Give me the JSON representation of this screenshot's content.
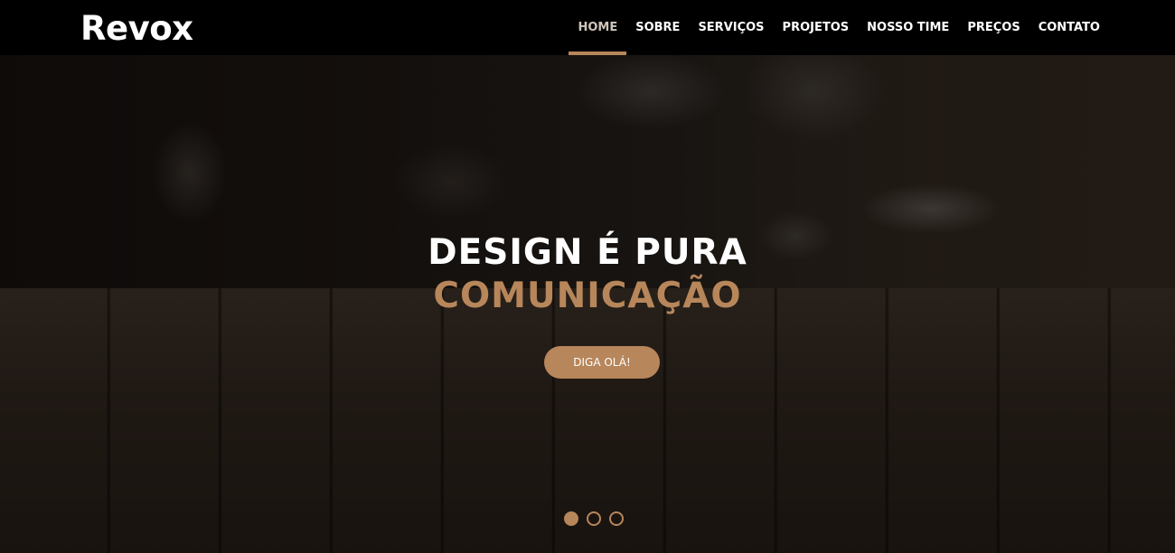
{
  "brand": {
    "name": "Revox"
  },
  "nav": {
    "items": [
      {
        "label": "HOME",
        "active": true
      },
      {
        "label": "SOBRE"
      },
      {
        "label": "SERVIÇOS"
      },
      {
        "label": "PROJETOS"
      },
      {
        "label": "NOSSO TIME"
      },
      {
        "label": "PREÇOS"
      },
      {
        "label": "CONTATO"
      }
    ]
  },
  "hero": {
    "title_line_1": "DESIGN É PURA",
    "title_line_2": "COMUNICAÇÃO",
    "cta_label": "DIGA OLÁ!",
    "slides": {
      "count": 3,
      "active_index": 0
    }
  },
  "colors": {
    "accent": "#b7865a",
    "navbar_bg": "#000000",
    "text": "#ffffff"
  }
}
